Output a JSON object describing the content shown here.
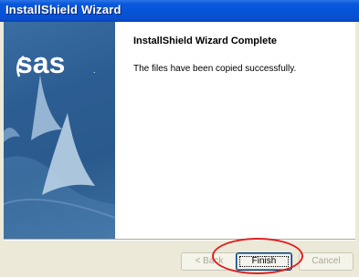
{
  "window": {
    "title": "InstallShield Wizard"
  },
  "brand": {
    "logo_text": "sas"
  },
  "content": {
    "heading": "InstallShield Wizard Complete",
    "message": "The files have been copied successfully."
  },
  "buttons": {
    "back_label": "< Back",
    "finish_label": "Finish",
    "cancel_label": "Cancel"
  },
  "colors": {
    "title_bar": "#0654d8",
    "side_panel": "#2c5d92",
    "annotation": "#e02020"
  }
}
